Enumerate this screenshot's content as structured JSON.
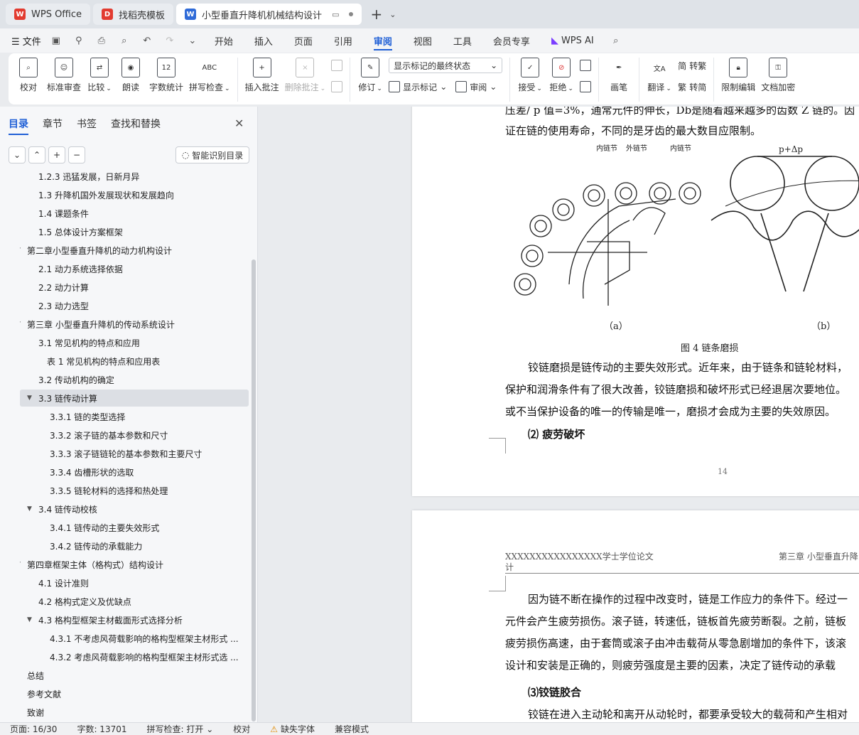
{
  "tabs": [
    {
      "label": "WPS Office",
      "logo": "W",
      "color": "#e23b30"
    },
    {
      "label": "找稻壳模板",
      "logo": "D",
      "color": "#e23b30"
    },
    {
      "label": "小型垂直升降机机械结构设计",
      "logo": "W",
      "color": "#2f6bd8"
    }
  ],
  "menubar": {
    "file": "文件",
    "items": [
      "开始",
      "插入",
      "页面",
      "引用",
      "审阅",
      "视图",
      "工具",
      "会员专享"
    ],
    "active": "审阅",
    "ai_label": "WPS AI"
  },
  "ribbon": {
    "proof": "校对",
    "std_review": "标准审查",
    "compare": "比较",
    "read_aloud": "朗读",
    "word_count": "字数统计",
    "spell_check": "拼写检查",
    "insert_comment": "插入批注",
    "delete_comment": "删除批注",
    "revise": "修订",
    "markup_select": "显示标记的最终状态",
    "show_markup": "显示标记",
    "review": "审阅",
    "accept": "接受",
    "reject": "拒绝",
    "pen": "画笔",
    "translate": "翻译",
    "to_traditional": "转繁",
    "to_simplified": "转简",
    "restrict_edit": "限制编辑",
    "doc_encrypt": "文档加密"
  },
  "sidebar": {
    "tabs": [
      "目录",
      "章节",
      "书签",
      "查找和替换"
    ],
    "smart_toc": "智能识别目录",
    "toc": [
      {
        "text": "1.2.3  迅猛发展，日新月异",
        "level": 2
      },
      {
        "text": "1.3  升降机国外发展现状和发展趋向",
        "level": 2
      },
      {
        "text": "1.4  课题条件",
        "level": 2
      },
      {
        "text": "1.5  总体设计方案框架",
        "level": 2
      },
      {
        "text": "第二章小型垂直升降机的动力机构设计",
        "level": 1,
        "arrow": true
      },
      {
        "text": "2.1  动力系统选择依据",
        "level": 2
      },
      {
        "text": "2.2  动力计算",
        "level": 2
      },
      {
        "text": "2.3  动力选型",
        "level": 2
      },
      {
        "text": "第三章  小型垂直升降机的传动系统设计",
        "level": 1,
        "arrow": true
      },
      {
        "text": "3.1 常见机构的特点和应用",
        "level": 2
      },
      {
        "text": "表 1  常见机构的特点和应用表",
        "level": 3
      },
      {
        "text": "3.2  传动机构的确定",
        "level": 2
      },
      {
        "text": "3.3  链传动计算",
        "level": 2,
        "arrow": true,
        "selected": true
      },
      {
        "text": "3.3.1  链的类型选择",
        "level": 4
      },
      {
        "text": "3.3.2  滚子链的基本参数和尺寸",
        "level": 4
      },
      {
        "text": "3.3.3  滚子链链轮的基本参数和主要尺寸",
        "level": 4
      },
      {
        "text": "3.3.4  齿槽形状的选取",
        "level": 4
      },
      {
        "text": "3.3.5  链轮材料的选择和热处理",
        "level": 4
      },
      {
        "text": "3.4  链传动校核",
        "level": 2,
        "arrow": true
      },
      {
        "text": "3.4.1  链传动的主要失效形式",
        "level": 4
      },
      {
        "text": "3.4.2  链传动的承载能力",
        "level": 4
      },
      {
        "text": "第四章框架主体（格构式）结构设计",
        "level": 1,
        "arrow": true
      },
      {
        "text": "4.1  设计准则",
        "level": 2
      },
      {
        "text": "4.2  格构式定义及优缺点",
        "level": 2
      },
      {
        "text": "4.3  格构型框架主材截面形式选择分析",
        "level": 2,
        "arrow": true
      },
      {
        "text": "4.3.1  不考虑风荷载影响的格构型框架主材形式 ...",
        "level": 4
      },
      {
        "text": "4.3.2  考虑风荷载影响的格构型框架主材形式选 ...",
        "level": 4
      },
      {
        "text": "总结",
        "level": 1
      },
      {
        "text": "参考文献",
        "level": 1
      },
      {
        "text": "致谢",
        "level": 1
      }
    ]
  },
  "document": {
    "page1": {
      "line_top": "压差/ p 值=3%，通常元件的伸长，Db是随着越来越多的齿数 Z 链的。因",
      "line_2": "证在链的使用寿命，不同的是牙齿的最大数目应限制。",
      "fig_labels": {
        "inner": "内链节",
        "outer": "外链节",
        "inner2": "内链节"
      },
      "sub_a": "（a）",
      "sub_b": "（b）",
      "fig_caption": "图 4    链条磨损",
      "para": [
        "铰链磨损是链传动的主要失效形式。近年来，由于链条和链轮材料，",
        "保护和润滑条件有了很大改善，铰链磨损和破坏形式已经退居次要地位。",
        "或不当保护设备的唯一的传输是唯一，磨损才会成为主要的失效原因。"
      ],
      "heading": "⑵ 疲劳破坏",
      "page_number": "14"
    },
    "page2": {
      "header_left_1": "XXXXXXXXXXXXXXXX学士学位论文",
      "header_left_2": "计",
      "header_right": "第三章  小型垂直升降",
      "para": [
        "因为链不断在操作的过程中改变时，链是工作应力的条件下。经过一",
        "元件会产生疲劳损伤。滚子链，转速低，链板首先疲劳断裂。之前，链板",
        "疲劳损伤高速，由于套筒或滚子由冲击载荷从零急剧增加的条件下，该滚",
        "设计和安装是正确的，则疲劳强度是主要的因素，决定了链传动的承载"
      ],
      "heading": "⑶铰链胶合",
      "last_line": "铰链在进入主动轮和离开从动轮时，都要承受较大的载荷和产生相对"
    }
  },
  "status": {
    "page": "页面: 16/30",
    "words": "字数: 13701",
    "spell": "拼写检查: 打开",
    "proof": "校对",
    "missing_font": "缺失字体",
    "compat": "兼容模式"
  }
}
